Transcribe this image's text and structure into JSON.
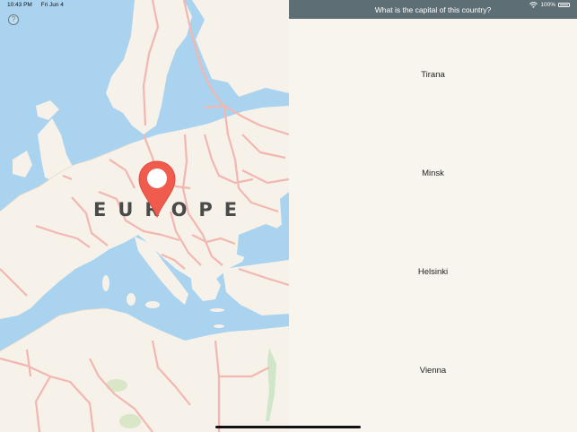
{
  "status_bar": {
    "time": "10:43 PM",
    "date": "Fri Jun 4",
    "battery": "100%",
    "wifi_icon": "wifi-icon",
    "battery_icon": "battery-icon"
  },
  "map": {
    "region_label": "EUROPE",
    "help_symbol": "?",
    "pin_icon": "location-pin-icon",
    "colors": {
      "water": "#a9d3ee",
      "land": "#f6f1e9",
      "border": "#f2b7b0",
      "pin": "#ef5c4e"
    }
  },
  "quiz": {
    "question": "What is the capital of this country?",
    "answers": [
      "Tirana",
      "Minsk",
      "Helsinki",
      "Vienna"
    ],
    "header_color": "#5d6f75"
  }
}
